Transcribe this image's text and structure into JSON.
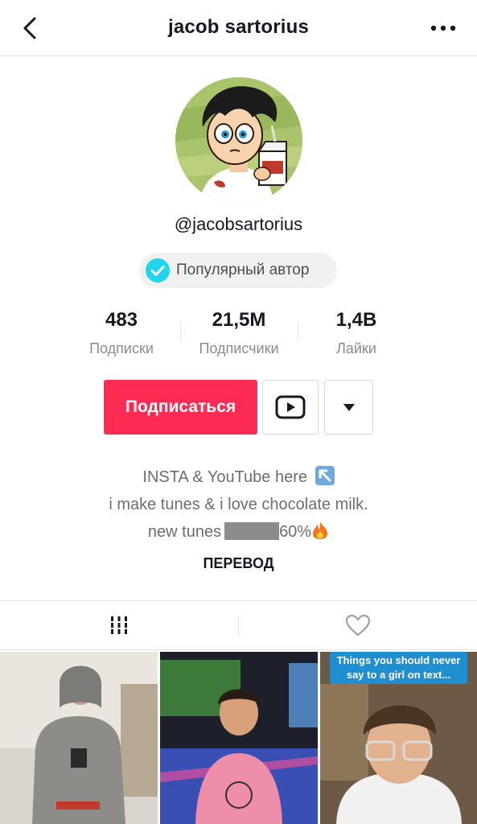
{
  "header": {
    "title": "jacob sartorius",
    "back_icon": "chevron-left-icon",
    "more_icon": "more-horizontal-icon"
  },
  "profile": {
    "handle": "@jacobsartorius",
    "badge_label": "Популярный автор",
    "badge_icon": "verified-check-icon",
    "stats": [
      {
        "value": "483",
        "label": "Подписки"
      },
      {
        "value": "21,5M",
        "label": "Подписчики"
      },
      {
        "value": "1,4B",
        "label": "Лайки"
      }
    ]
  },
  "actions": {
    "follow_label": "Подписаться",
    "youtube_icon": "youtube-icon",
    "dropdown_icon": "caret-down-icon"
  },
  "bio": {
    "line1": "INSTA & YouTube here",
    "line2": "i make tunes & i love chocolate milk.",
    "line3_prefix": "new tunes",
    "line3_suffix": "60%",
    "translate_label": "ПЕРЕВОД"
  },
  "tabs": [
    {
      "name": "videos",
      "icon": "grid-bars-icon",
      "active": true
    },
    {
      "name": "liked",
      "icon": "heart-outline-icon",
      "active": false
    }
  ],
  "videos": [
    {
      "caption": ""
    },
    {
      "caption": ""
    },
    {
      "caption": "Things you should never say to a girl on text..."
    }
  ],
  "colors": {
    "accent": "#fe2c55",
    "badge_check": "#20d5ec",
    "text_primary": "#161823",
    "text_secondary": "#8a8b91"
  }
}
